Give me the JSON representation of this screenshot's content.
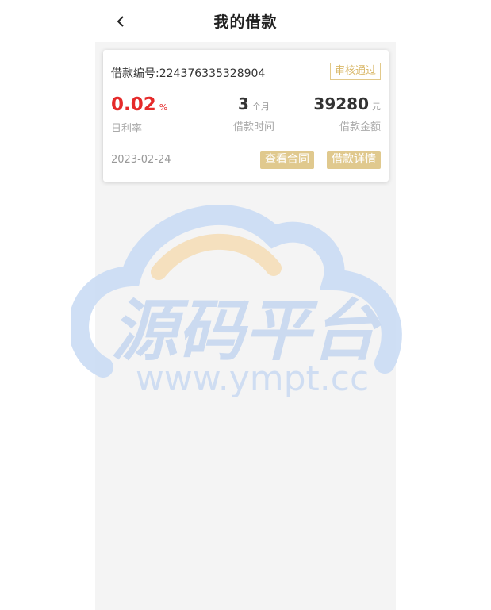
{
  "header": {
    "title": "我的借款"
  },
  "loan": {
    "number_label": "借款编号:224376335328904",
    "status": "审核通过",
    "rate_value": "0.02",
    "rate_unit": "%",
    "rate_label": "日利率",
    "term_value": "3",
    "term_unit": "个月",
    "term_label": "借款时间",
    "amount_value": "39280",
    "amount_unit": "元",
    "amount_label": "借款金额",
    "date": "2023-02-24",
    "contract_button": "查看合同",
    "detail_button": "借款详情"
  },
  "watermark": {
    "brand": "源码平台",
    "url": "www.ympt.cc"
  },
  "colors": {
    "accent": "#e0c98e",
    "rate_red": "#e52a2a"
  },
  "icons": {
    "back": "chevron-left-icon"
  }
}
